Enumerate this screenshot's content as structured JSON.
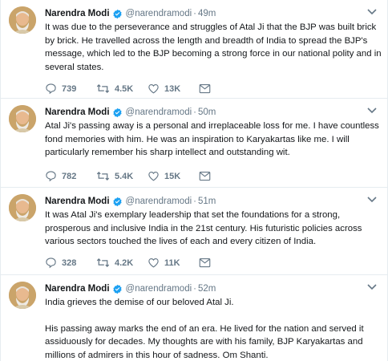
{
  "tweets": [
    {
      "author": "Narendra Modi",
      "handle": "@narendramodi",
      "separator": "·",
      "time": "49m",
      "text": [
        "It was due to the perseverance and struggles of Atal Ji that the BJP was built brick by brick. He travelled across the length and breadth of India to spread the BJP's message, which led to the BJP becoming a strong force in our national polity and in several states."
      ],
      "replies": "739",
      "retweets": "4.5K",
      "likes": "13K"
    },
    {
      "author": "Narendra Modi",
      "handle": "@narendramodi",
      "separator": "·",
      "time": "50m",
      "text": [
        "Atal Ji's passing away is a personal and irreplaceable loss for me. I have countless fond memories with him. He was an inspiration to Karyakartas like me. I will particularly remember his sharp intellect and outstanding wit."
      ],
      "replies": "782",
      "retweets": "5.4K",
      "likes": "15K"
    },
    {
      "author": "Narendra Modi",
      "handle": "@narendramodi",
      "separator": "·",
      "time": "51m",
      "text": [
        "It was Atal Ji's exemplary leadership that set the foundations for a strong, prosperous and inclusive India in the 21st century. His futuristic policies across various sectors touched the lives of each and every citizen of India."
      ],
      "replies": "328",
      "retweets": "4.2K",
      "likes": "11K"
    },
    {
      "author": "Narendra Modi",
      "handle": "@narendramodi",
      "separator": "·",
      "time": "52m",
      "text": [
        "India grieves the demise of our beloved Atal Ji.",
        "His passing away marks the end of an era. He lived for the nation and served it assiduously for decades. My thoughts are with his family, BJP Karyakartas and millions of admirers in this hour of sadness. Om Shanti."
      ]
    }
  ],
  "icons": {
    "avatar": "avatar-photo",
    "verified": "verified-badge-icon",
    "caret": "chevron-down-icon",
    "reply": "reply-icon",
    "retweet": "retweet-icon",
    "like": "heart-icon",
    "message": "direct-message-icon"
  },
  "colors": {
    "verified": "#1da1f2",
    "meta": "#657786",
    "text": "#14171a",
    "divider": "#e6ecf0"
  }
}
